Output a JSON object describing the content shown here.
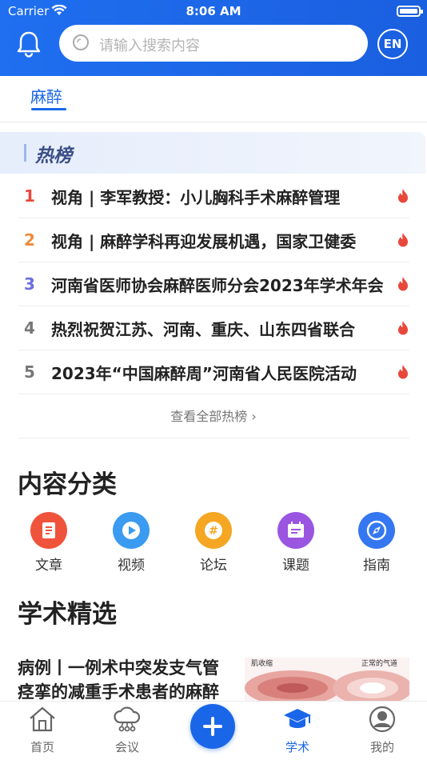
{
  "status_bar": {
    "carrier": "Carrier",
    "time": "8:06 AM"
  },
  "header": {
    "search_placeholder": "请输入搜索内容",
    "lang_button": "EN"
  },
  "tabs": [
    {
      "label": "麻醉",
      "active": true
    }
  ],
  "hot": {
    "title": "热榜",
    "items": [
      {
        "rank": "1",
        "title": "视角 | 李军教授：小儿胸科手术麻醉管理",
        "rank_color": "#e8473b"
      },
      {
        "rank": "2",
        "title": " 视角 | 麻醉学科再迎发展机遇，国家卫健委",
        "rank_color": "#f08a3a"
      },
      {
        "rank": "3",
        "title": "河南省医师协会麻醉医师分会2023年学术年会",
        "rank_color": "#6a6fe0"
      },
      {
        "rank": "4",
        "title": "热烈祝贺江苏、河南、重庆、山东四省联合",
        "rank_color": "#777777"
      },
      {
        "rank": "5",
        "title": "2023年“中国麻醉周”河南省人民医院活动",
        "rank_color": "#777777"
      }
    ],
    "see_all": "查看全部热榜 ›"
  },
  "categories": {
    "title": "内容分类",
    "items": [
      {
        "label": "文章",
        "icon": "article-icon",
        "color": "#f0533b"
      },
      {
        "label": "视频",
        "icon": "video-icon",
        "color": "#3b9bf0"
      },
      {
        "label": "论坛",
        "icon": "forum-icon",
        "color": "#f5a623"
      },
      {
        "label": "课题",
        "icon": "topic-icon",
        "color": "#9a56e0"
      },
      {
        "label": "指南",
        "icon": "guide-icon",
        "color": "#3577f0"
      }
    ]
  },
  "academic": {
    "title": "学术精选",
    "articles": [
      {
        "title": "病例丨一例术中突发支气管痉挛的减重手术患者的麻醉管理",
        "thumb_label_left": "肌收缩",
        "thumb_label_right": "正常的气道"
      }
    ]
  },
  "tabbar": {
    "items": [
      {
        "label": "首页",
        "icon": "home-icon",
        "active": false
      },
      {
        "label": "会议",
        "icon": "meeting-icon",
        "active": false
      },
      {
        "label": "学术",
        "icon": "academic-icon",
        "active": true
      },
      {
        "label": "我的",
        "icon": "profile-icon",
        "active": false
      }
    ],
    "center_icon": "plus-icon"
  },
  "colors": {
    "primary": "#1a66e8",
    "header_bg": "#1f6ff0",
    "fire": "#e8473b"
  }
}
